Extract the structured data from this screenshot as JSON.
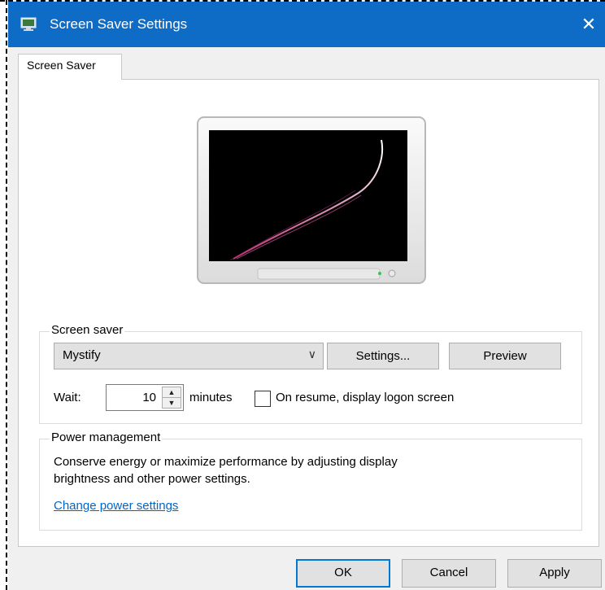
{
  "window": {
    "title": "Screen Saver Settings",
    "close_glyph": "✕",
    "tab": "Screen Saver"
  },
  "screen_saver": {
    "group_label": "Screen saver",
    "selected": "Mystify",
    "settings_button": "Settings...",
    "preview_button": "Preview",
    "wait_label": "Wait:",
    "wait_value": "10",
    "minutes_label": "minutes",
    "resume_label": "On resume, display logon screen",
    "resume_checked": false
  },
  "power": {
    "group_label": "Power management",
    "description_line1": "Conserve energy or maximize performance by adjusting display",
    "description_line2": "brightness and other power settings.",
    "link": "Change power settings"
  },
  "footer": {
    "ok": "OK",
    "cancel": "Cancel",
    "apply": "Apply"
  },
  "icons": {
    "title": "screen-saver-icon",
    "close": "close-icon",
    "dropdown": "chevron-down-icon",
    "spin_up": "spin-up-icon",
    "spin_down": "spin-down-icon",
    "monitor": "monitor-preview-icon"
  },
  "colors": {
    "titlebar": "#0f6cc6",
    "link": "#0066cc",
    "focus": "#0078d7"
  }
}
